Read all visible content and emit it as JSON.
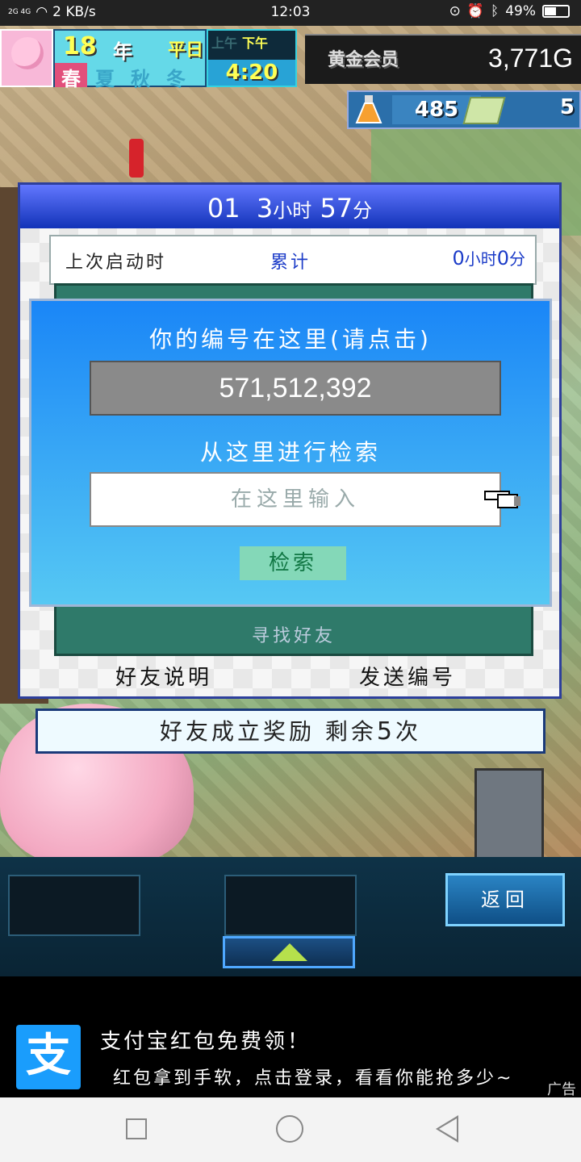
{
  "status_bar": {
    "network": "2G 4G",
    "speed": "2 KB/s",
    "time": "12:03",
    "battery": "49%"
  },
  "hud": {
    "year": "18",
    "year_unit": "年",
    "day_type": "平日",
    "seasons": [
      "春",
      "夏",
      "秋",
      "冬"
    ],
    "active_season": "春",
    "am_label": "上午",
    "pm_label": "下午",
    "clock": "4:20",
    "member_label": "黄金会员",
    "gold": "3,771G",
    "research_points": "485",
    "tickets": "5"
  },
  "friend_panel": {
    "title_id": "01",
    "title_hours": "3",
    "title_hours_unit": "小时",
    "title_minutes": "57",
    "title_minutes_unit": "分",
    "last_launch_label": "上次启动时",
    "total_label": "累计",
    "total_hours": "0",
    "total_hours_unit": "小时",
    "total_minutes": "0",
    "total_minutes_unit": "分",
    "hidden_button": "寻找好友",
    "help_button": "好友说明",
    "send_button": "发送编号"
  },
  "reward": {
    "label": "好友成立奖励 剩余",
    "count": "5",
    "unit": "次"
  },
  "dialog": {
    "id_prompt": "你的编号在这里(请点击)",
    "id_value": "571,512,392",
    "search_prompt": "从这里进行检索",
    "search_placeholder": "在这里输入",
    "search_button": "检索"
  },
  "toolbar": {
    "back_button": "返回"
  },
  "ad": {
    "logo": "支",
    "title": "支付宝红包免费领！",
    "desc": "红包拿到手软，点击登录，看看你能抢多少~",
    "tag": "广告"
  },
  "colors": {
    "dialog_blue": "#1a86f7",
    "panel_title_blue": "#1233b8",
    "search_button_green": "#84d8b8",
    "alipay_blue": "#1a9dfc"
  }
}
